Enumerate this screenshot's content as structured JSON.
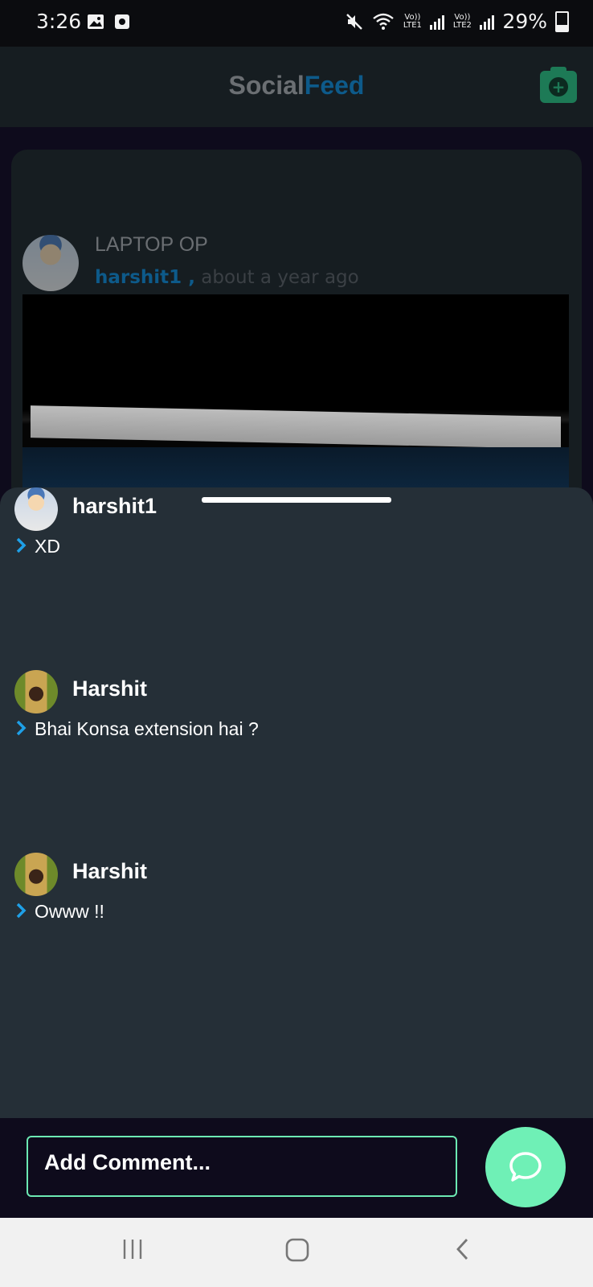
{
  "status_bar": {
    "time": "3:26",
    "battery": "29%",
    "sim1": "Vo)) LTE1",
    "sim2": "Vo)) LTE2"
  },
  "app_bar": {
    "brand_part1": "Social",
    "brand_part2": "Feed",
    "camera_icon": "camera-plus-icon",
    "colors": {
      "brand_dim": "#6b6f73",
      "brand_accent": "#0d5a8a",
      "camera_bg": "#1d7a56"
    }
  },
  "post": {
    "title": "LAPTOP OP",
    "author": "harshit1 ,",
    "time": " about a year ago"
  },
  "comments": [
    {
      "name": "harshit1",
      "text": "XD"
    },
    {
      "name": "Harshit",
      "text": "Bhai Konsa extension hai ?"
    },
    {
      "name": "Harshit",
      "text": "Owww !!"
    }
  ],
  "composer": {
    "placeholder": "Add Comment...",
    "send_icon": "chat-bubble-icon",
    "colors": {
      "border": "#6ce9b3",
      "send_bg": "#6ff0b6"
    }
  },
  "nav": {
    "recents_icon": "recents-icon",
    "home_icon": "home-icon",
    "back_icon": "back-icon"
  }
}
